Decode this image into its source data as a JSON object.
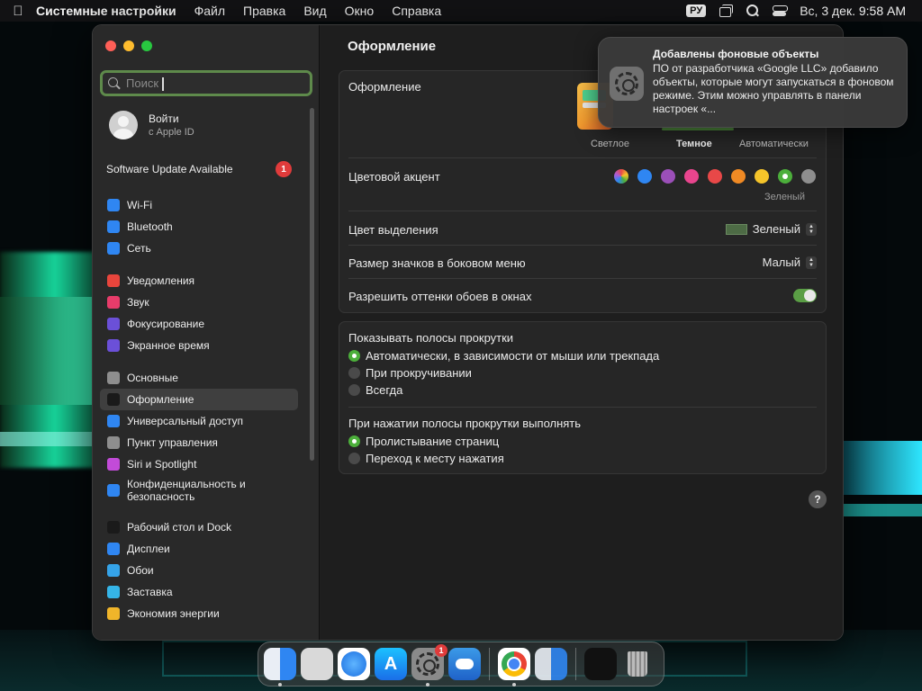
{
  "menubar": {
    "app_name": "Системные настройки",
    "items": [
      "Файл",
      "Правка",
      "Вид",
      "Окно",
      "Справка"
    ],
    "input_lang": "РУ",
    "datetime": "Вс, 3 дек.  9:58 AM"
  },
  "sidebar": {
    "search_placeholder": "Поиск",
    "signin": {
      "title": "Войти",
      "subtitle": "с Apple ID"
    },
    "update": {
      "label": "Software Update Available",
      "badge": "1"
    },
    "groups": [
      [
        {
          "label": "Wi-Fi",
          "icon": "wifi-icon",
          "color": "#2f86f2"
        },
        {
          "label": "Bluetooth",
          "icon": "bluetooth-icon",
          "color": "#2f86f2"
        },
        {
          "label": "Сеть",
          "icon": "globe-icon",
          "color": "#2f86f2"
        }
      ],
      [
        {
          "label": "Уведомления",
          "icon": "bell-icon",
          "color": "#e8453c"
        },
        {
          "label": "Звук",
          "icon": "speaker-icon",
          "color": "#e83c6a"
        },
        {
          "label": "Фокусирование",
          "icon": "moon-icon",
          "color": "#6b50d8"
        },
        {
          "label": "Экранное время",
          "icon": "hourglass-icon",
          "color": "#6b50d8"
        }
      ],
      [
        {
          "label": "Основные",
          "icon": "gear-icon",
          "color": "#8e8e8e"
        },
        {
          "label": "Оформление",
          "icon": "appearance-icon",
          "color": "#1a1a1a",
          "active": true
        },
        {
          "label": "Универсальный доступ",
          "icon": "accessibility-icon",
          "color": "#2f86f2"
        },
        {
          "label": "Пункт управления",
          "icon": "control-center-icon",
          "color": "#8e8e8e"
        },
        {
          "label": "Siri и Spotlight",
          "icon": "siri-icon",
          "color": "#c24bd8"
        },
        {
          "label": "Конфиденциальность и безопасность",
          "icon": "hand-icon",
          "color": "#2f86f2",
          "tall": true
        }
      ],
      [
        {
          "label": "Рабочий стол и Dock",
          "icon": "desktop-icon",
          "color": "#1a1a1a"
        },
        {
          "label": "Дисплеи",
          "icon": "display-icon",
          "color": "#2f86f2"
        },
        {
          "label": "Обои",
          "icon": "wallpaper-icon",
          "color": "#35a3e8"
        },
        {
          "label": "Заставка",
          "icon": "screensaver-icon",
          "color": "#35b5e8"
        },
        {
          "label": "Экономия энергии",
          "icon": "bulb-icon",
          "color": "#f0b52a"
        }
      ]
    ]
  },
  "main": {
    "title": "Оформление",
    "appearance": {
      "label": "Оформление",
      "options": [
        "Светлое",
        "Темное",
        "Автоматически"
      ],
      "selected": "Темное"
    },
    "accent": {
      "label": "Цветовой акцент",
      "colors": [
        "#ab5cd8",
        "#2f86f2",
        "#9b4fb8",
        "#e8458e",
        "#e84848",
        "#f08a24",
        "#f5c42a",
        "#4caf3b",
        "#8e8e8e"
      ],
      "selected_index": 7,
      "selected_name": "Зеленый"
    },
    "highlight": {
      "label": "Цвет выделения",
      "value": "Зеленый",
      "swatch": "#4d6b45"
    },
    "icon_size": {
      "label": "Размер значков в боковом меню",
      "value": "Малый"
    },
    "wallpaper_tint": {
      "label": "Разрешить оттенки обоев в окнах",
      "on": true
    },
    "scrollbars": {
      "label": "Показывать полосы прокрутки",
      "options": [
        "Автоматически, в зависимости от мыши или трекпада",
        "При прокручивании",
        "Всегда"
      ],
      "selected": 0
    },
    "click_scrollbar": {
      "label": "При нажатии полосы прокрутки выполнять",
      "options": [
        "Пролистывание страниц",
        "Переход к месту нажатия"
      ],
      "selected": 0
    },
    "help": "?"
  },
  "notification": {
    "title": "Добавлены фоновые объекты",
    "body": "ПО от разработчика «Google LLC» добавило объекты, которые могут запускаться в фоновом режиме. Этим можно управлять в панели настроек «..."
  },
  "dock": {
    "apps": [
      "Finder",
      "Launchpad",
      "Safari",
      "App Store",
      "Системные настройки",
      "Погода",
      "Google Chrome",
      "Finder",
      "Снимок экрана",
      "Корзина"
    ],
    "sysprefs_badge": "1"
  }
}
